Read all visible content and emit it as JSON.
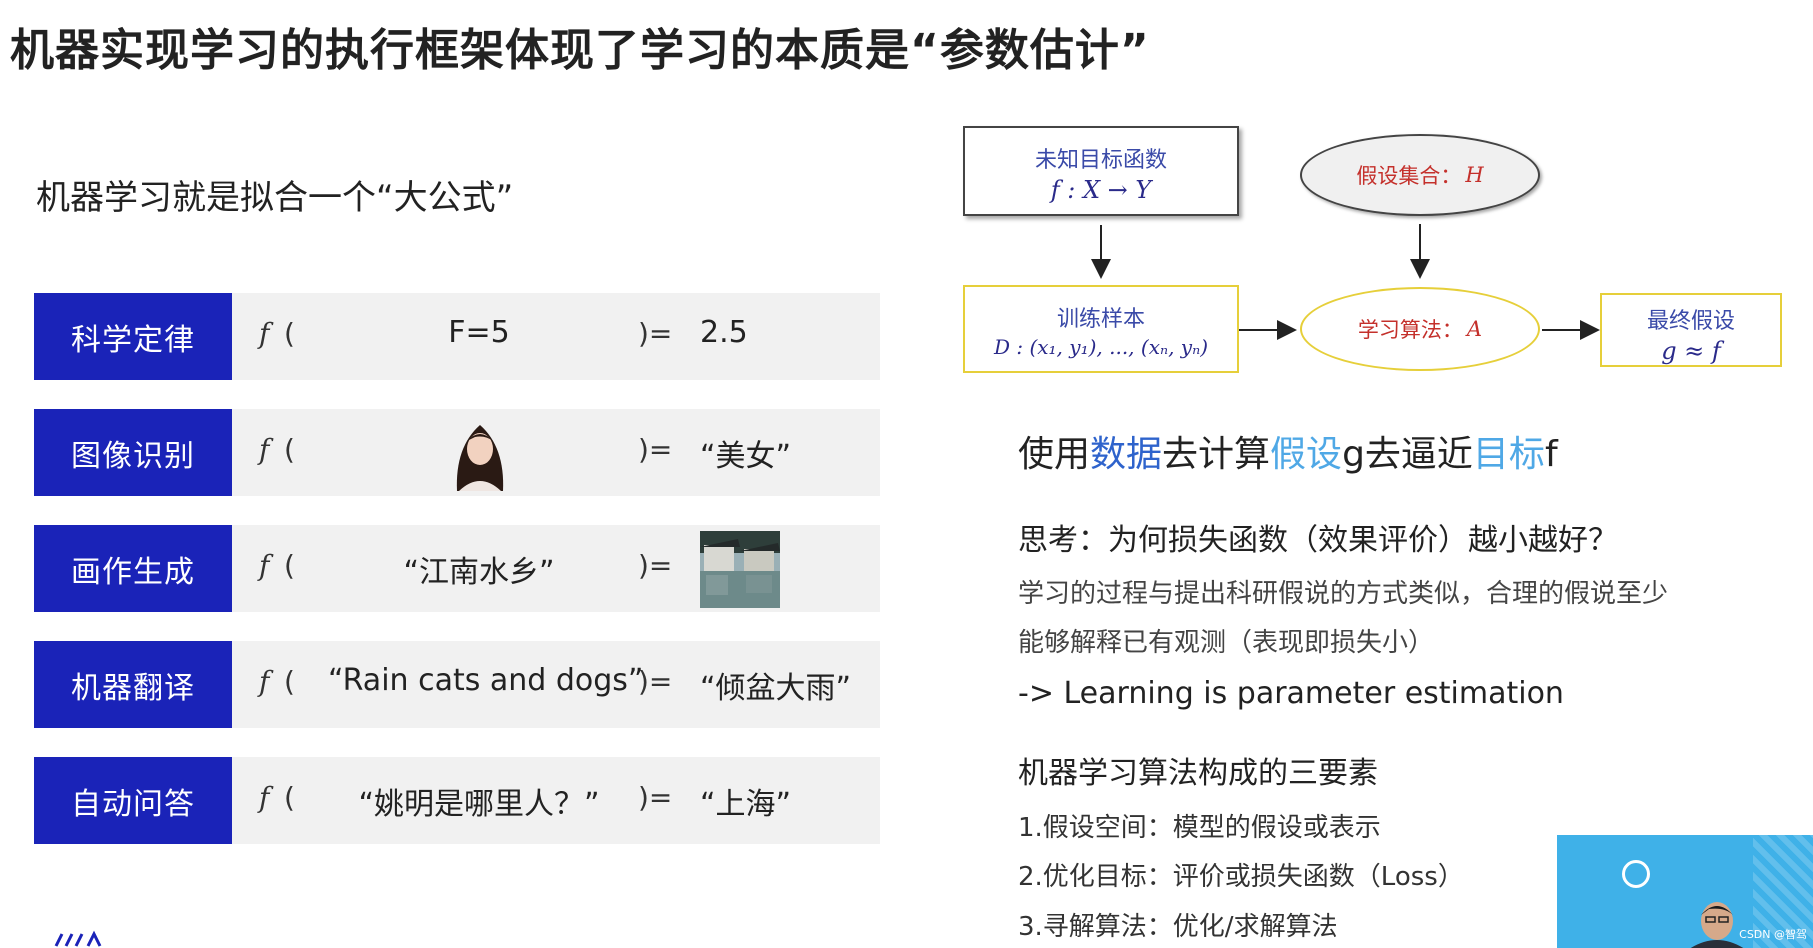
{
  "title": "机器实现学习的执行框架体现了学习的本质是“参数估计”",
  "subtitle": "机器学习就是拟合一个“大公式”",
  "rows": [
    {
      "category": "科学定律",
      "f": "f",
      "open": "(",
      "input": "F=5",
      "eq": ")=",
      "output": "2.5"
    },
    {
      "category": "图像识别",
      "f": "f",
      "open": "(",
      "input": "",
      "eq": ")=",
      "output": "“美女”"
    },
    {
      "category": "画作生成",
      "f": "f",
      "open": "(",
      "input": "“江南水乡”",
      "eq": ")=",
      "output": ""
    },
    {
      "category": "机器翻译",
      "f": "f",
      "open": "(",
      "input": "“Rain cats and dogs”",
      "eq": ")=",
      "output": "“倾盆大雨”"
    },
    {
      "category": "自动问答",
      "f": "f",
      "open": "(",
      "input": "“姚明是哪里人？”",
      "eq": ")=",
      "output": "“上海”"
    }
  ],
  "diagram": {
    "target": {
      "label": "未知目标函数",
      "formula": "f : X → Y"
    },
    "hypothesis_set": {
      "label": "假设集合：",
      "symbol": "H"
    },
    "samples": {
      "label": "训练样本",
      "formula": "D : (x₁, y₁), ..., (xₙ, yₙ)"
    },
    "algorithm": {
      "label": "学习算法：",
      "symbol": "A"
    },
    "final": {
      "label": "最终假设",
      "formula": "g ≈ f"
    }
  },
  "usage": {
    "p1": "使用",
    "p2": "数据",
    "p3": "去计算",
    "p4": "假设",
    "p5": "g去逼近",
    "p6": "目标",
    "p7": "f"
  },
  "think": "思考：为何损失函数（效果评价）越小越好？",
  "para1": "学习的过程与提出科研假说的方式类似，合理的假说至少",
  "para2": "能够解释已有观测（表现即损失小）",
  "learning": "-> Learning is parameter estimation",
  "three_title": "机器学习算法构成的三要素",
  "items": [
    "1.假设空间：模型的假设或表示",
    "2.优化目标：评价或损失函数（Loss）",
    "3.寻解算法：优化/求解算法"
  ],
  "watermark": "CSDN @智驾"
}
